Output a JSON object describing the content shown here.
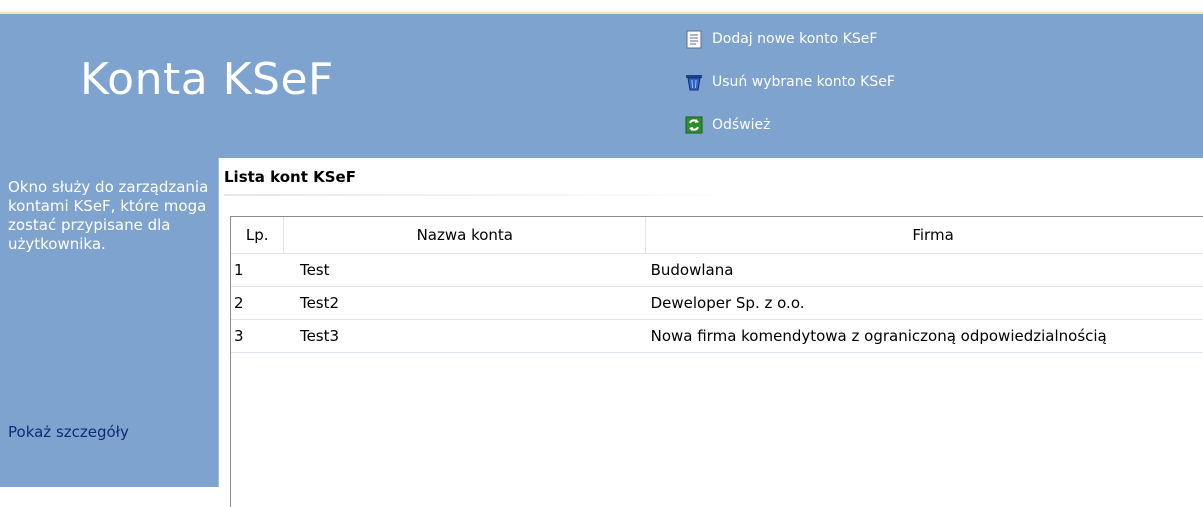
{
  "header": {
    "title": "Konta KSeF",
    "actions": [
      {
        "label": "Dodaj nowe konto KSeF",
        "icon": "document-icon"
      },
      {
        "label": "Usuń wybrane konto KSeF",
        "icon": "trash-icon"
      },
      {
        "label": "Odśwież",
        "icon": "refresh-icon"
      }
    ]
  },
  "sidebar": {
    "description": "Okno służy do zarządzania kontami KSeF, które moga zostać przypisane dla użytkownika.",
    "details_link": "Pokaż szczegóły"
  },
  "panel": {
    "title": "Lista kont KSeF"
  },
  "table": {
    "columns": [
      "Lp.",
      "Nazwa konta",
      "Firma"
    ],
    "rows": [
      {
        "lp": "1",
        "name": "Test",
        "firm": "Budowlana"
      },
      {
        "lp": "2",
        "name": "Test2",
        "firm": "Deweloper Sp. z o.o."
      },
      {
        "lp": "3",
        "name": "Test3",
        "firm": "Nowa firma komendytowa z ograniczoną odpowiedzialnością"
      }
    ]
  },
  "colors": {
    "header_bg": "#7ea3cf",
    "link": "#0f2a78"
  }
}
